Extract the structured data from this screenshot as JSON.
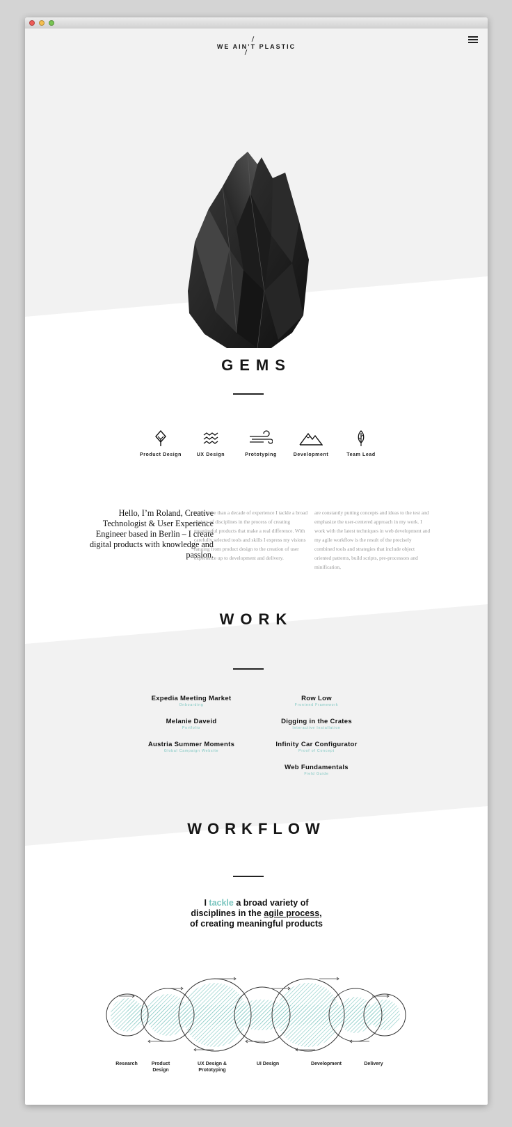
{
  "browser": {
    "buttons": [
      "close",
      "minimize",
      "zoom"
    ]
  },
  "logo": {
    "text": "WE AIN’T PLASTIC"
  },
  "menu": {
    "icon": "hamburger-icon"
  },
  "hero": {
    "image": "black-gem-crystal"
  },
  "gems": {
    "title": "GEMS",
    "skills": [
      {
        "label": "Product Design",
        "icon": "diamond-leaf-icon"
      },
      {
        "label": "UX Design",
        "icon": "waves-icon"
      },
      {
        "label": "Prototyping",
        "icon": "wind-icon"
      },
      {
        "label": "Development",
        "icon": "mountain-icon"
      },
      {
        "label": "Team Lead",
        "icon": "feather-icon"
      }
    ],
    "intro": "Hello, I’m Roland, Creative Technologist & User Experience Engineer based in Berlin – I create digital products with knowledge and passion.",
    "body_col1": "With more than a decade of experience I tackle a broad variety of disciplines in the process of creating meaningful products that make a real difference. With carefully selected tools and skills I express my visions ranging from product design to the creation of user experience up to development and delivery.",
    "body_col2": "are constantly putting concepts and ideas to the test and emphasize the user-centered approach in my work. I work with the latest techniques in web development and my agile workflow is the result of the precisely combined tools and strategies that include object oriented patterns, build scripts, pre-processors and minification,"
  },
  "work": {
    "title": "WORK",
    "left": [
      {
        "title": "Expedia Meeting Market",
        "subtitle": "Onboarding"
      },
      {
        "title": "Melanie Daveid",
        "subtitle": "Portfolio"
      },
      {
        "title": "Austria Summer Moments",
        "subtitle": "Global Campaign Website"
      }
    ],
    "right": [
      {
        "title": "Row Low",
        "subtitle": "Frontend Framework"
      },
      {
        "title": "Digging in the Crates",
        "subtitle": "Interactive Installation"
      },
      {
        "title": "Infinity Car Configurator",
        "subtitle": "Proof of Concept"
      },
      {
        "title": "Web Fundamentals",
        "subtitle": "Field Guide"
      }
    ]
  },
  "workflow": {
    "title": "WORKFLOW",
    "line1_pre": "I ",
    "line1_accent": "tackle",
    "line1_post": " a broad variety of",
    "line2_pre": "disciplines in the ",
    "line2_link": "agile process,",
    "line3": "of creating meaningful products",
    "steps": [
      "Research",
      "Product Design",
      "UX Design & Prototyping",
      "UI Design",
      "Development",
      "Delivery"
    ]
  },
  "colors": {
    "accent": "#7cc6c0",
    "light_band": "#f2f2f2",
    "text": "#111111"
  }
}
